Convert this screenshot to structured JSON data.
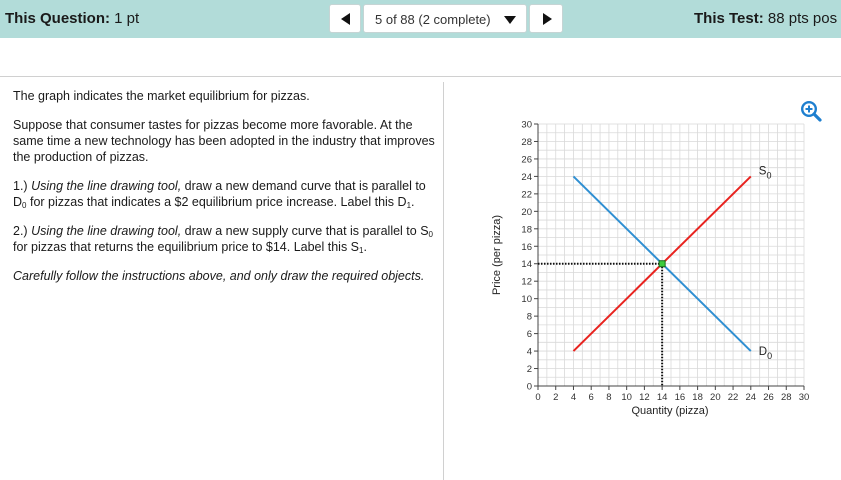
{
  "header": {
    "question_label": "This Question:",
    "question_points": "1 pt",
    "progress": "5 of 88 (2 complete)",
    "test_label": "This Test:",
    "test_points": "88 pts pos"
  },
  "question": {
    "intro": "The graph indicates the market equilibrium for pizzas.",
    "scenario": "Suppose that consumer tastes for pizzas become more favorable. At the same time a new technology has been adopted in the industry that improves the production of pizzas.",
    "q1_num": "1.)",
    "q1_tool": "Using the line drawing tool,",
    "q1_a": "draw a new demand curve that is parallel to D",
    "q1_sub0": "0",
    "q1_b": "for pizzas that indicates a $2 equilibrium price increase. Label this D",
    "q1_sub1": "1",
    "q1_end": ".",
    "q2_num": "2.)",
    "q2_tool": "Using the line drawing tool,",
    "q2_a": "draw a new supply curve that is parallel to S",
    "q2_sub0": "0",
    "q2_b": "for pizzas that returns the equilibrium price to $14. Label this S",
    "q2_sub1": "1",
    "q2_end": ".",
    "instruction": "Carefully follow the instructions above, and only draw the required objects."
  },
  "chart_data": {
    "type": "line",
    "xlabel": "Quantity (pizza)",
    "ylabel": "Price (per pizza)",
    "xlim": [
      0,
      30
    ],
    "ylim": [
      0,
      30
    ],
    "x_ticks": [
      0,
      2,
      4,
      6,
      8,
      10,
      12,
      14,
      16,
      18,
      20,
      22,
      24,
      26,
      28,
      30
    ],
    "y_ticks": [
      0,
      2,
      4,
      6,
      8,
      10,
      12,
      14,
      16,
      18,
      20,
      22,
      24,
      26,
      28,
      30
    ],
    "grid": true,
    "series": [
      {
        "name": "S",
        "sub": "0",
        "color": "#e8231f",
        "points": [
          [
            4,
            4
          ],
          [
            24,
            24
          ]
        ]
      },
      {
        "name": "D",
        "sub": "0",
        "color": "#2f8fd2",
        "points": [
          [
            4,
            24
          ],
          [
            24,
            4
          ]
        ]
      }
    ],
    "equilibrium": {
      "x": 14,
      "y": 14,
      "color": "#3ccd3c"
    }
  },
  "icons": {
    "zoom": "zoom-in-icon"
  }
}
